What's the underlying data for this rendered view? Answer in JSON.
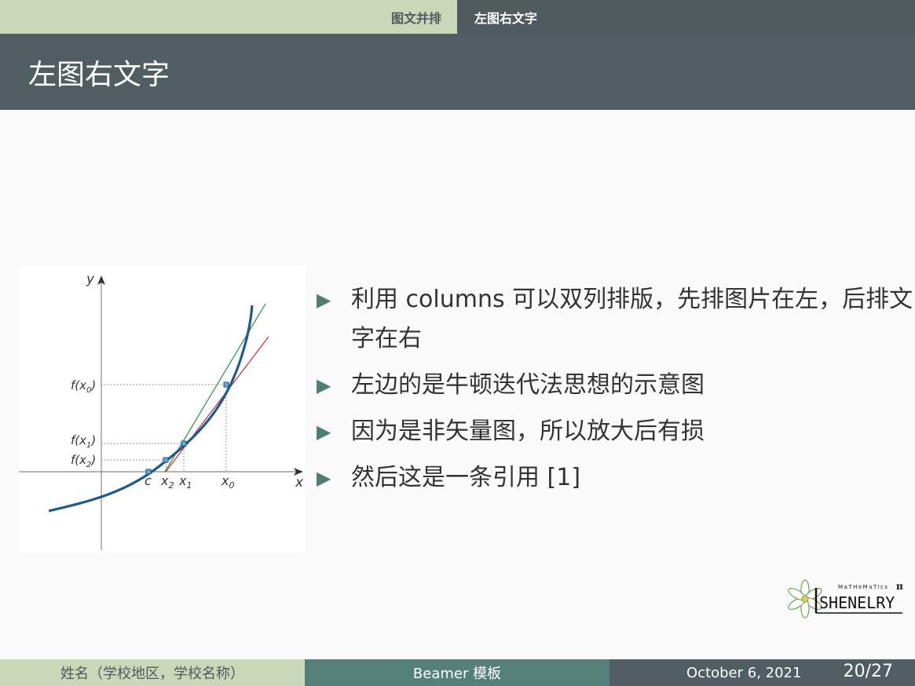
{
  "nav": {
    "sections": [
      {
        "label": "图文并排"
      },
      {
        "label": "左图右文字",
        "active": true
      }
    ]
  },
  "slide": {
    "title": "左图右文字",
    "bullets": [
      "利用 columns 可以双列排版，先排图片在左，后排文字在右",
      "左边的是牛顿迭代法思想的示意图",
      "因为是非矢量图，所以放大后有损",
      "然后这是一条引用 [1]"
    ]
  },
  "figure": {
    "axis_x": "x",
    "axis_y": "y",
    "x_ticks": [
      "c",
      "x2",
      "x1",
      "x0"
    ],
    "y_ticks": [
      "f(x0)",
      "f(x1)",
      "f(x2)"
    ]
  },
  "logo": {
    "top_text": "MaTHeMaTics",
    "name": "SHENELRY",
    "symbol": "π"
  },
  "footer": {
    "author": "姓名（学校地区，学校名称）",
    "title": "Beamer 模板",
    "date": "October 6, 2021",
    "page_current": "20",
    "page_total": "27"
  },
  "colors": {
    "nav_light": "#c8d8b8",
    "dark_slate": "#505d62",
    "teal": "#55807a",
    "bullet_arrow": "#4f7f73",
    "curve": "#1e5a8c",
    "tangent_red": "#d9303a",
    "tangent_green": "#3a9a4a"
  }
}
